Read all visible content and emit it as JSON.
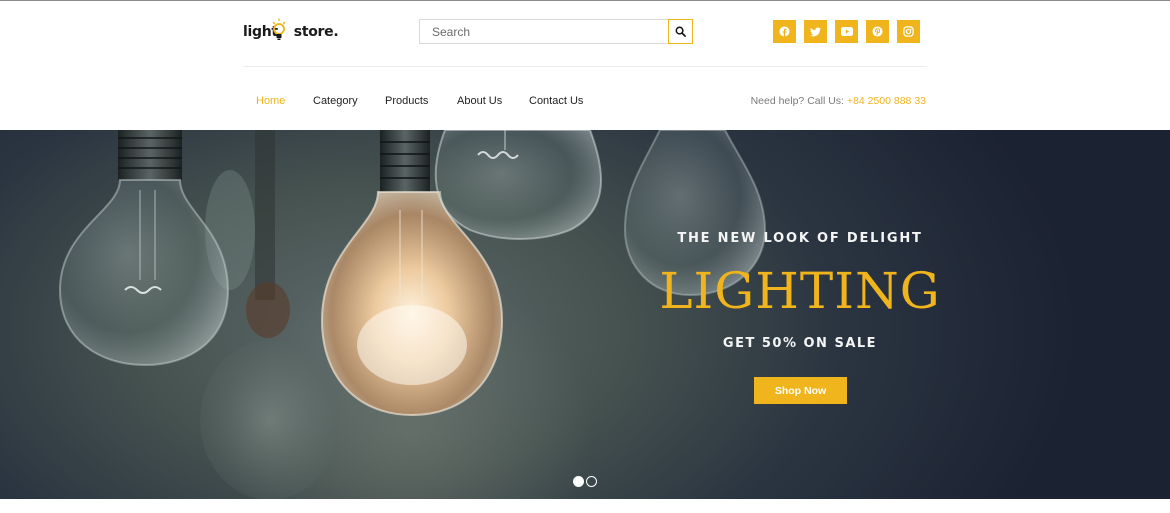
{
  "brand": {
    "logo_text_left": "light",
    "logo_text_right": "store.",
    "accent_color": "#f0b41c"
  },
  "search": {
    "placeholder": "Search",
    "icon": "search-icon"
  },
  "socials": [
    {
      "icon": "facebook-icon"
    },
    {
      "icon": "twitter-icon"
    },
    {
      "icon": "youtube-icon"
    },
    {
      "icon": "pinterest-icon"
    },
    {
      "icon": "instagram-icon"
    }
  ],
  "nav": {
    "items": [
      {
        "label": "Home",
        "active": true
      },
      {
        "label": "Category",
        "active": false
      },
      {
        "label": "Products",
        "active": false
      },
      {
        "label": "About Us",
        "active": false
      },
      {
        "label": "Contact Us",
        "active": false
      }
    ]
  },
  "help": {
    "text": "Need help? Call Us: ",
    "phone": "+84 2500 888 33"
  },
  "hero": {
    "subtitle": "THE NEW LOOK OF DELIGHT",
    "title": "LIGHTING",
    "sale": "GET 50% ON SALE",
    "button_label": "Shop Now",
    "slides_total": 2,
    "active_slide": 1
  }
}
